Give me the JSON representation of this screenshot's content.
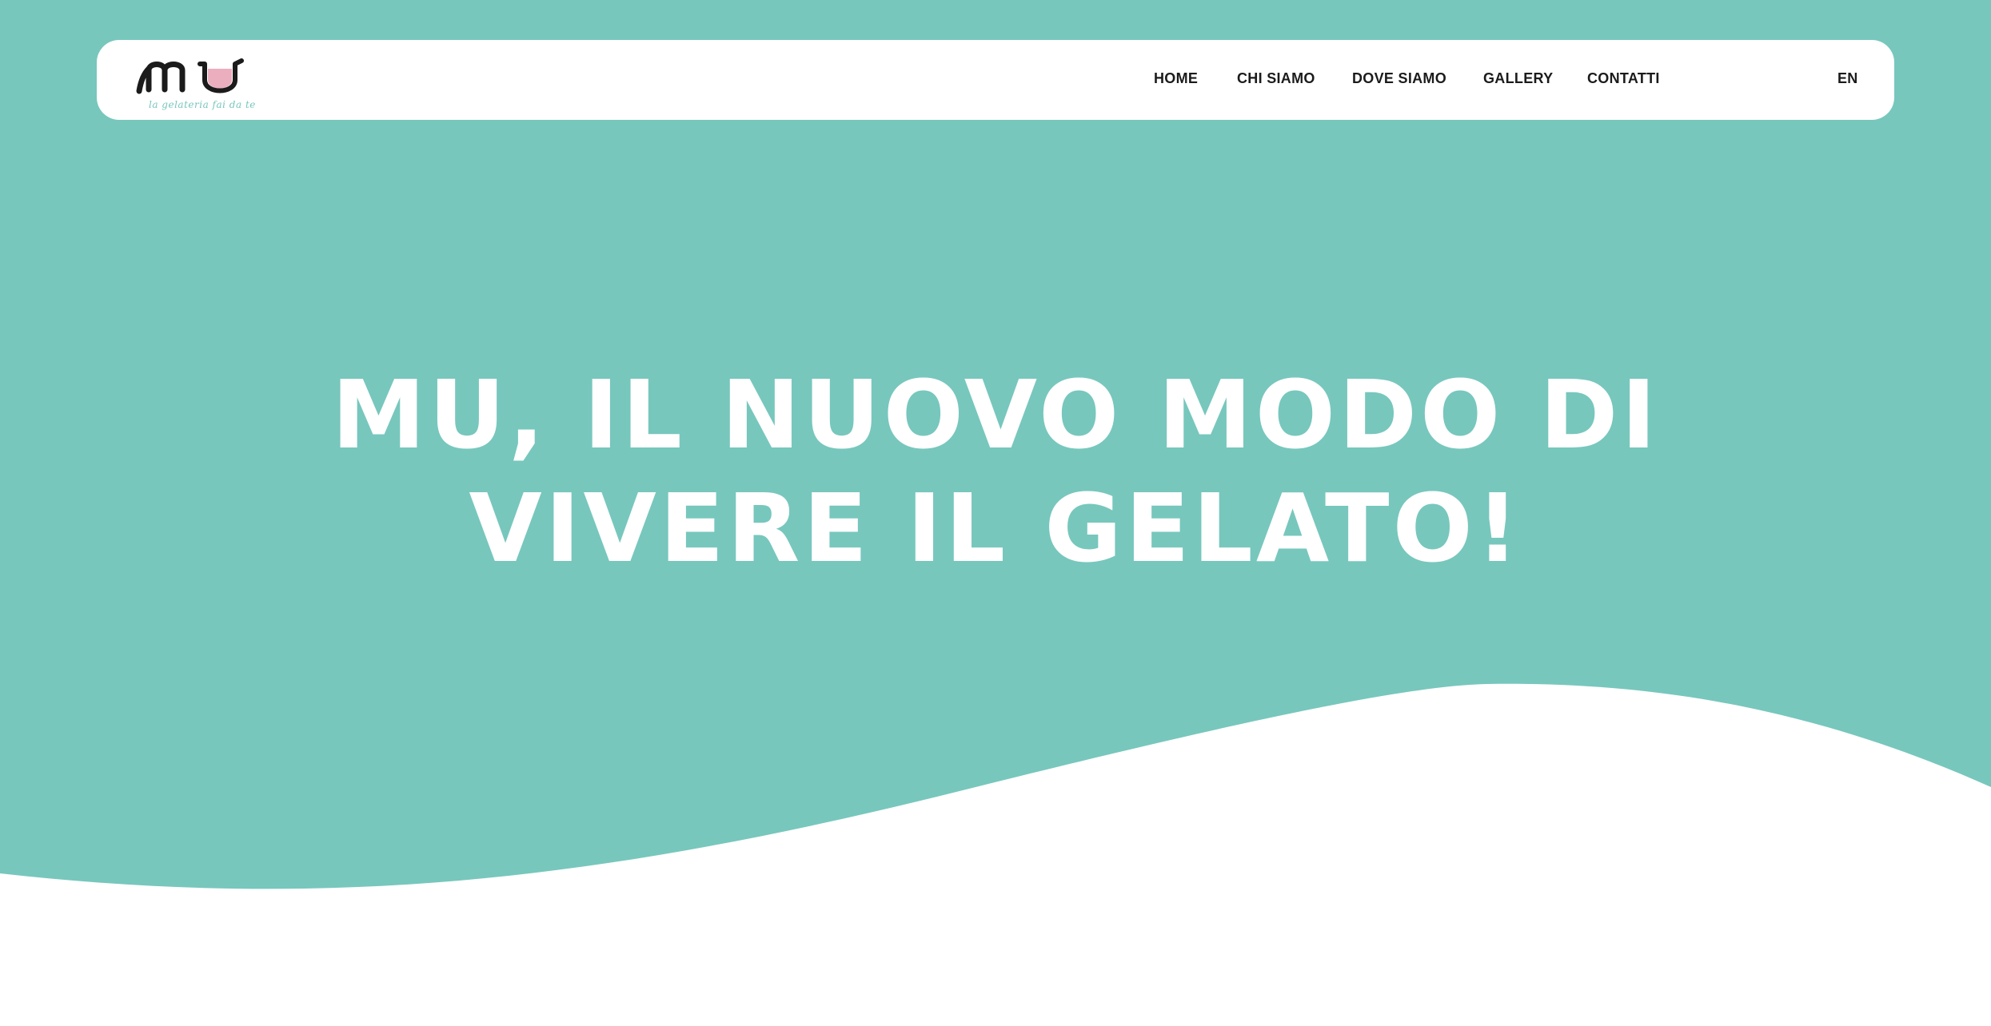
{
  "brand": {
    "logo_text": "MU",
    "tagline": "la gelateria fai da te",
    "colors": {
      "background": "#77c7bd",
      "navbar": "#ffffff",
      "text_dark": "#1b1b1b",
      "logo_accent": "#e8a0b4"
    }
  },
  "nav": {
    "items": [
      {
        "label": "HOME"
      },
      {
        "label": "CHI SIAMO"
      },
      {
        "label": "DOVE SIAMO"
      },
      {
        "label": "GALLERY"
      },
      {
        "label": "CONTATTI"
      }
    ],
    "language": "EN"
  },
  "hero": {
    "line1": "MU, IL NUOVO MODO DI",
    "line2": "VIVERE IL GELATO!"
  }
}
